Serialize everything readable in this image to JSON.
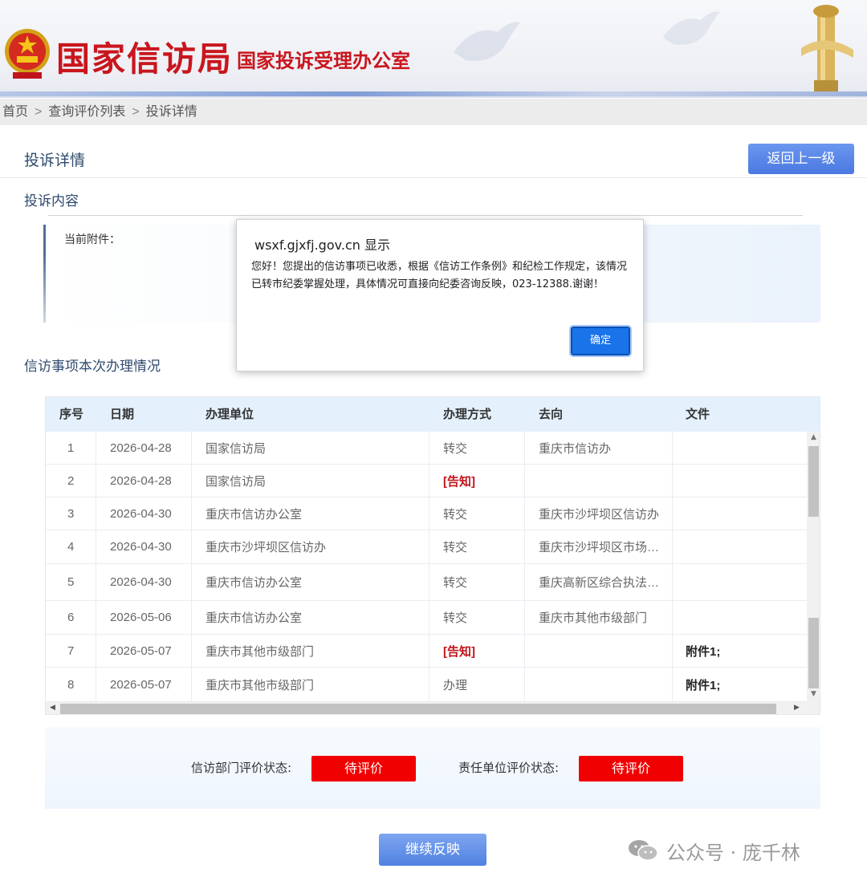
{
  "header": {
    "title_main": "国家信访局",
    "title_sub": "国家投诉受理办公室"
  },
  "breadcrumb": [
    "首页",
    "查询评价列表",
    "投诉详情"
  ],
  "page": {
    "title": "投诉详情",
    "back_button": "返回上一级",
    "section_content": "投诉内容",
    "attachment_label": "当前附件：",
    "section_progress": "信访事项本次办理情况"
  },
  "table": {
    "headers": [
      "序号",
      "日期",
      "办理单位",
      "办理方式",
      "去向",
      "文件"
    ],
    "rows": [
      {
        "no": "1",
        "date": "2026-04-28",
        "unit": "国家信访局",
        "method": "转交",
        "dest": "重庆市信访办",
        "file": ""
      },
      {
        "no": "2",
        "date": "2026-04-28",
        "unit": "国家信访局",
        "method": "[告知]",
        "dest": "",
        "file": ""
      },
      {
        "no": "3",
        "date": "2026-04-30",
        "unit": "重庆市信访办公室",
        "method": "转交",
        "dest": "重庆市沙坪坝区信访办",
        "file": ""
      },
      {
        "no": "4",
        "date": "2026-04-30",
        "unit": "重庆市沙坪坝区信访办",
        "method": "转交",
        "dest": "重庆市沙坪坝区市场…",
        "file": ""
      },
      {
        "no": "5",
        "date": "2026-04-30",
        "unit": "重庆市信访办公室",
        "method": "转交",
        "dest": "重庆高新区综合执法…",
        "file": ""
      },
      {
        "no": "6",
        "date": "2026-05-06",
        "unit": "重庆市信访办公室",
        "method": "转交",
        "dest": "重庆市其他市级部门",
        "file": ""
      },
      {
        "no": "7",
        "date": "2026-05-07",
        "unit": "重庆市其他市级部门",
        "method": "[告知]",
        "dest": "",
        "file": "附件1;"
      },
      {
        "no": "8",
        "date": "2026-05-07",
        "unit": "重庆市其他市级部门",
        "method": "办理",
        "dest": "",
        "file": "附件1;"
      }
    ]
  },
  "evaluation": {
    "dept_label": "信访部门评价状态:",
    "dept_status": "待评价",
    "unit_label": "责任单位评价状态:",
    "unit_status": "待评价"
  },
  "continue_button": "继续反映",
  "watermark": "公众号 · 庞千林",
  "dialog": {
    "origin": "wsxf.gjxfj.gov.cn 显示",
    "message": "您好！您提出的信访事项已收悉，根据《信访工作条例》和纪检工作规定，该情况已转市纪委掌握处理，具体情况可直接向纪委咨询反映，023-12388.谢谢！",
    "ok_button": "确定"
  },
  "colors": {
    "brand_red": "#c9161d",
    "notice_red": "#c0141c",
    "status_red": "#f00000",
    "primary_blue": "#4a78e0"
  }
}
